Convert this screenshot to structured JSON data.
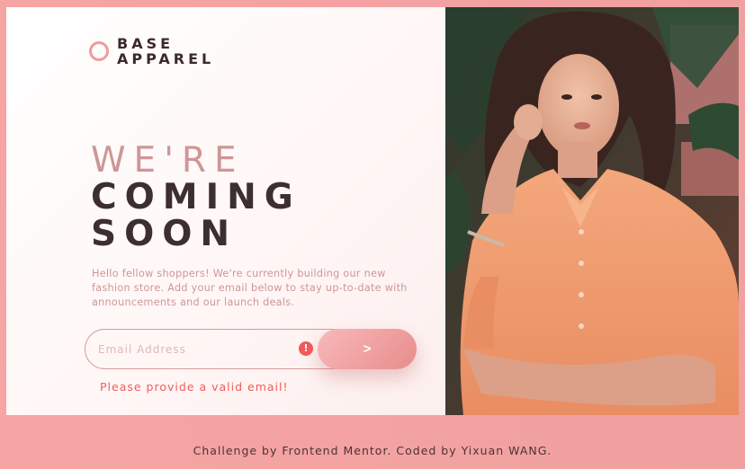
{
  "brand": {
    "line1": "BASE",
    "line2": "APPAREL"
  },
  "headline": {
    "line1": "WE'RE",
    "line2": "COMING",
    "line3": "SOON"
  },
  "description": "Hello fellow shoppers! We're currently building our new fashion store. Add your email below to stay up-to-date with announcements and our launch deals.",
  "form": {
    "email_placeholder": "Email Address",
    "email_value": "",
    "submit_symbol": ">",
    "error_icon": "!",
    "error_message": "Please provide a valid email!"
  },
  "footer": {
    "text": "Challenge by Frontend Mentor. Coded by Yixuan WANG."
  },
  "colors": {
    "accent": "#ce9695",
    "accent_light": "#f6a4a4",
    "text_dark": "#3d2f2f",
    "error": "#f25b5b"
  },
  "icons": {
    "logo": "ring-logo-icon",
    "submit": "arrow-right-icon",
    "error": "error-exclamation-icon"
  }
}
